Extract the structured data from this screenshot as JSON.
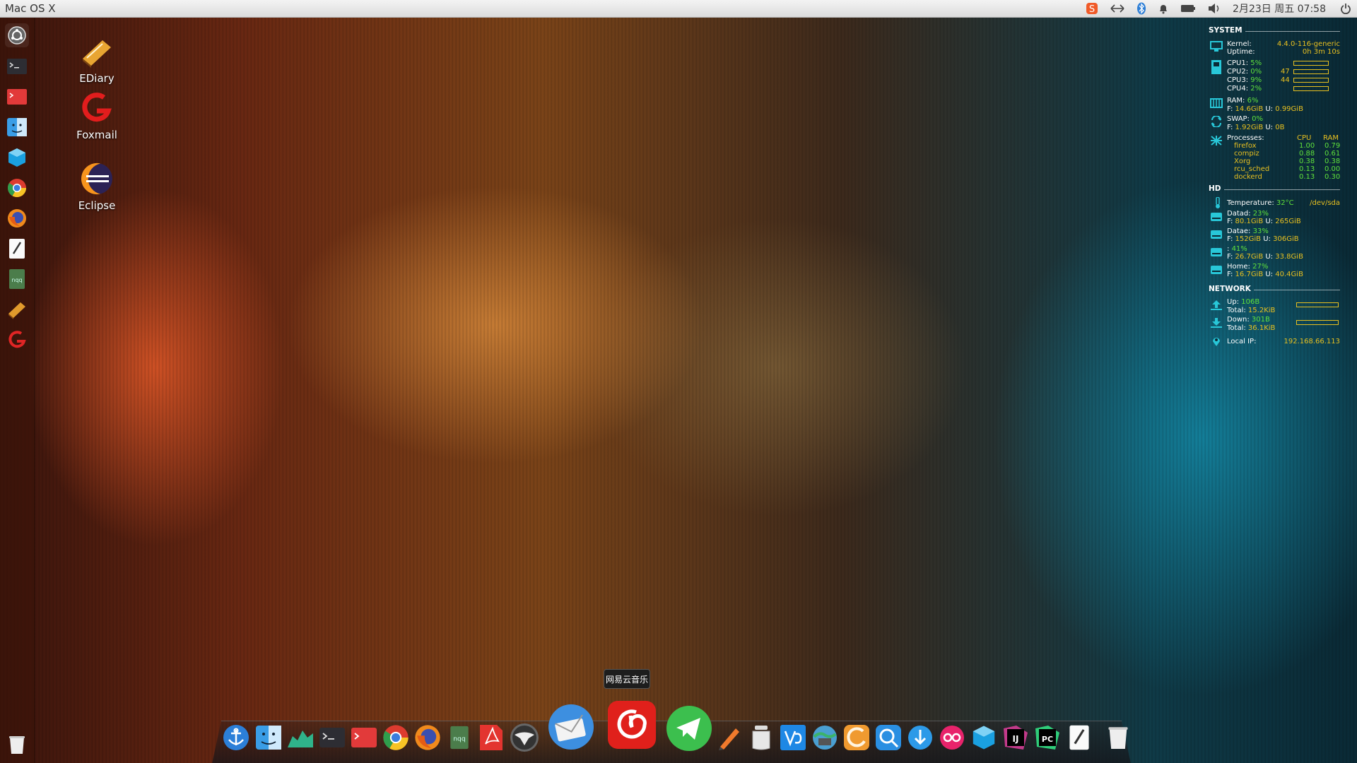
{
  "top_panel": {
    "app_title": "Mac OS X",
    "datetime": "2月23日 周五 07:58",
    "indicators": [
      "sogou-input-icon",
      "network-arrows-icon",
      "bluetooth-icon",
      "notification-bell-icon",
      "battery-icon",
      "volume-icon",
      "power-icon"
    ]
  },
  "launcher": {
    "items": [
      "ubuntu-dash-icon",
      "terminal-icon",
      "terminal-red-icon",
      "finder-icon",
      "virtualbox-icon",
      "chrome-icon",
      "firefox-icon",
      "text-editor-icon",
      "nqq-notepad-icon",
      "ediary-icon",
      "foxmail-icon"
    ],
    "trash": "trash-icon"
  },
  "desktop": {
    "icons": [
      {
        "label": "EDiary",
        "icon": "ediary-icon"
      },
      {
        "label": "Foxmail",
        "icon": "foxmail-icon"
      },
      {
        "label": "Eclipse",
        "icon": "eclipse-icon"
      }
    ]
  },
  "conky": {
    "system": {
      "heading": "SYSTEM",
      "kernel_label": "Kernel:",
      "kernel_value": "4.4.0-116-generic",
      "uptime_label": "Uptime:",
      "uptime_value": "0h 3m 10s",
      "cpus": [
        {
          "label": "CPU1:",
          "value": "5%",
          "extra": ""
        },
        {
          "label": "CPU2:",
          "value": "0%",
          "extra": "47"
        },
        {
          "label": "CPU3:",
          "value": "9%",
          "extra": "44"
        },
        {
          "label": "CPU4:",
          "value": "2%",
          "extra": ""
        }
      ],
      "ram_label": "RAM:",
      "ram_value": "6%",
      "ram_detail_f_label": "F:",
      "ram_detail_f": "14.6GiB",
      "ram_detail_u_label": "U:",
      "ram_detail_u": "0.99GiB",
      "swap_label": "SWAP:",
      "swap_value": "0%",
      "swap_detail_f_label": "F:",
      "swap_detail_f": "1.92GiB",
      "swap_detail_u_label": "U:",
      "swap_detail_u": "0B",
      "processes_label": "Processes:",
      "cpu_col": "CPU",
      "ram_col": "RAM",
      "processes": [
        {
          "name": "firefox",
          "cpu": "1.00",
          "ram": "0.79"
        },
        {
          "name": "compiz",
          "cpu": "0.88",
          "ram": "0.61"
        },
        {
          "name": "Xorg",
          "cpu": "0.38",
          "ram": "0.38"
        },
        {
          "name": "rcu_sched",
          "cpu": "0.13",
          "ram": "0.00"
        },
        {
          "name": "dockerd",
          "cpu": "0.13",
          "ram": "0.30"
        }
      ]
    },
    "hd": {
      "heading": "HD",
      "temp_label": "Temperature:",
      "temp_value": "32°C",
      "temp_device": "/dev/sda",
      "disks": [
        {
          "label": "Datad:",
          "pct": "23%",
          "f": "80.1GiB",
          "u": "265GiB"
        },
        {
          "label": "Datae:",
          "pct": "33%",
          "f": "152GiB",
          "u": "306GiB"
        },
        {
          "label": ":",
          "pct": "41%",
          "f": "26.7GiB",
          "u": "33.8GiB"
        },
        {
          "label": "Home:",
          "pct": "27%",
          "f": "16.7GiB",
          "u": "40.4GiB"
        }
      ],
      "f_label": "F:",
      "u_label": "U:"
    },
    "network": {
      "heading": "NETWORK",
      "up_label": "Up:",
      "up_value": "106B",
      "up_total_label": "Total:",
      "up_total": "15.2KiB",
      "down_label": "Down:",
      "down_value": "301B",
      "down_total_label": "Total:",
      "down_total": "36.1KiB",
      "ip_label": "Local IP:",
      "ip_value": "192.168.66.113"
    }
  },
  "dock": {
    "tooltip": "网易云音乐",
    "items": [
      "anchor-icon",
      "finder-icon",
      "system-monitor-icon",
      "terminal-icon",
      "terminal-red-icon",
      "chrome-icon",
      "firefox-icon",
      "nqq-notepad-icon",
      "pdf-reader-icon",
      "eagle-icon",
      "thunderbird-icon",
      "netease-music-icon",
      "telegram-icon",
      "pencil-icon",
      "jar-icon",
      "vscode-icon",
      "network-globe-icon",
      "sublime-icon",
      "edge-browser-icon",
      "download-icon",
      "flickr-icon",
      "virtualbox-icon",
      "intellij-icon",
      "pycharm-icon",
      "text-editor-icon",
      "trash-icon"
    ]
  },
  "colors": {
    "conky_accent": "#e8c020",
    "conky_green": "#5fe13b",
    "conky_icon": "#28c7d8"
  }
}
